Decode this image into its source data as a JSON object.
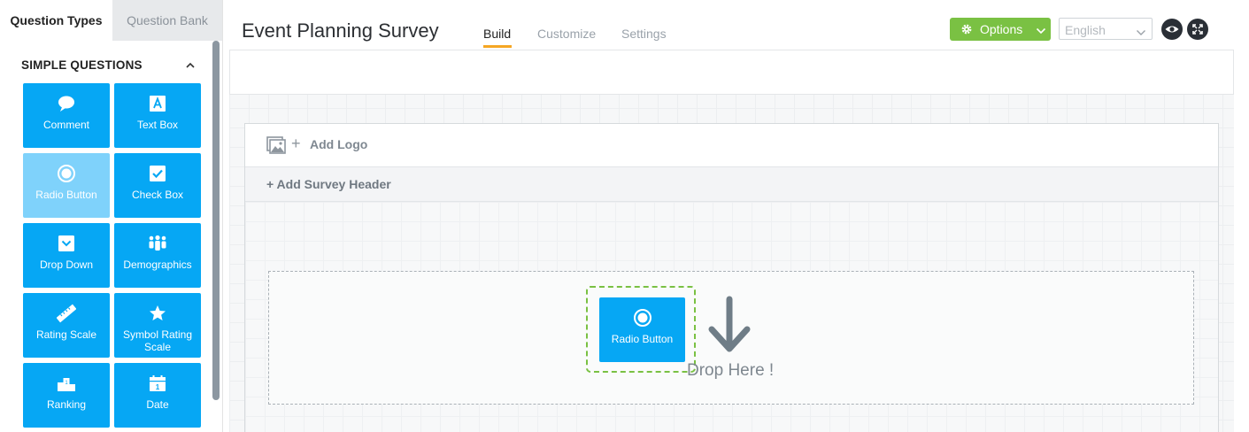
{
  "sidebar": {
    "tabs": [
      {
        "label": "Question Types",
        "active": true
      },
      {
        "label": "Question Bank",
        "active": false
      }
    ],
    "section_title": "SIMPLE QUESTIONS",
    "tiles": [
      {
        "label": "Comment",
        "icon": "comment-icon"
      },
      {
        "label": "Text Box",
        "icon": "text-box-icon"
      },
      {
        "label": "Radio Button",
        "icon": "radio-icon",
        "state": "dragging"
      },
      {
        "label": "Check Box",
        "icon": "checkbox-icon"
      },
      {
        "label": "Drop Down",
        "icon": "dropdown-icon"
      },
      {
        "label": "Demographics",
        "icon": "people-icon"
      },
      {
        "label": "Rating Scale",
        "icon": "ruler-icon"
      },
      {
        "label": "Symbol Rating Scale",
        "icon": "star-icon"
      },
      {
        "label": "Ranking",
        "icon": "podium-icon"
      },
      {
        "label": "Date",
        "icon": "calendar-icon"
      }
    ]
  },
  "header": {
    "title": "Event Planning Survey",
    "nav": [
      {
        "label": "Build",
        "active": true
      },
      {
        "label": "Customize",
        "active": false
      },
      {
        "label": "Settings",
        "active": false
      }
    ],
    "options_label": "Options",
    "language": "English"
  },
  "survey": {
    "add_logo": "Add Logo",
    "add_header": "+ Add Survey Header",
    "drop_text": "Drop Here !",
    "drag_item": "Radio Button"
  },
  "colors": {
    "tile_blue": "#06a7f4",
    "tile_light": "#7fd2fb",
    "options_green": "#7ac143",
    "active_underline": "#f5a623"
  }
}
